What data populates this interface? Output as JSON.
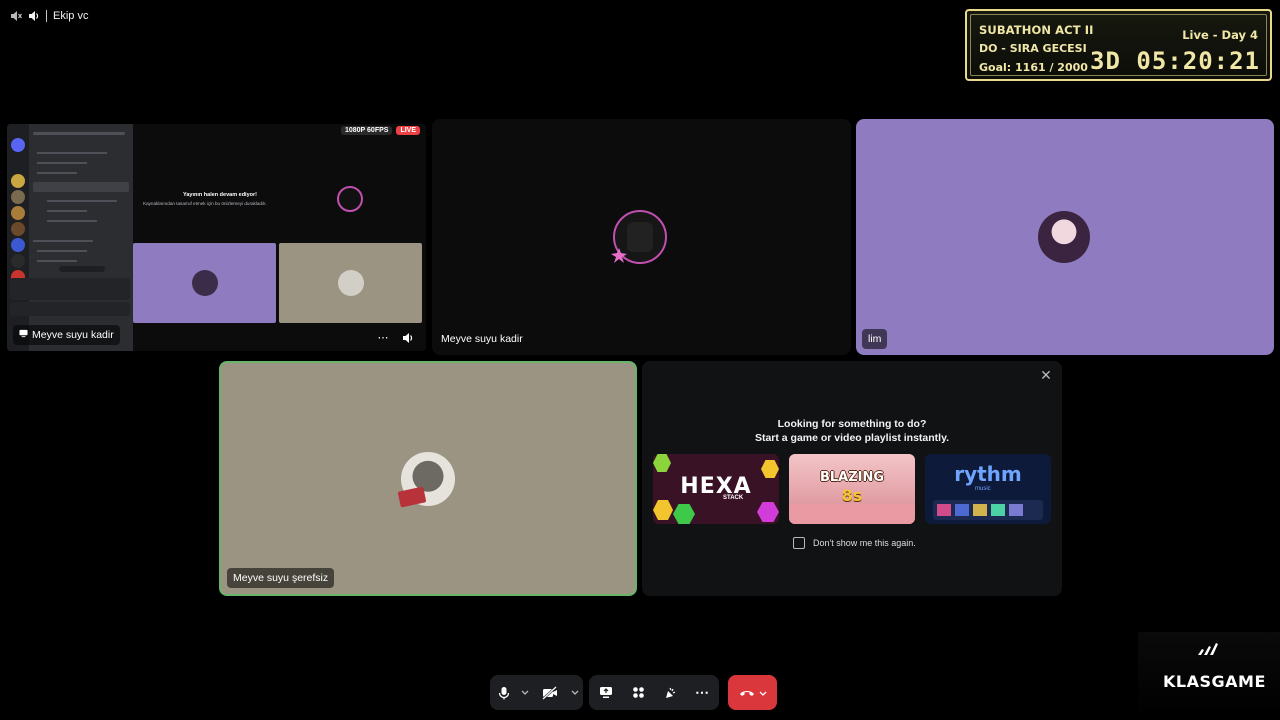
{
  "header": {
    "channel_name": "Ekip vc",
    "deafen_icon": "speaker-muted-icon",
    "volume_icon": "speaker-icon"
  },
  "subathon": {
    "title": "SUBATHON ACT II",
    "status": "Live - Day 4",
    "subtitle": "DO - SIRA GECESI",
    "goal": "Goal: 1161 / 2000",
    "timer": "3D 05:20:21"
  },
  "tiles": {
    "screen_share": {
      "name": "Meyve suyu kadir",
      "quality_badge": "1080P 60FPS",
      "live_badge": "LIVE",
      "inner_message_title": "Yayının halen devam ediyor!",
      "inner_message_body": "Kaynaklarından tasarruf etmek için bu önizlemeyi durakladık."
    },
    "middle": {
      "name": "Meyve suyu kadir"
    },
    "right": {
      "name": "lim"
    },
    "speaker": {
      "name": "Meyve suyu şerefsiz"
    }
  },
  "activity": {
    "heading_line1": "Looking for something to do?",
    "heading_line2": "Start a game or video playlist instantly.",
    "cards": [
      {
        "title": "HEXA",
        "subtitle": "STACK"
      },
      {
        "title": "BLAZING",
        "subtitle": "8s"
      },
      {
        "title": "rythm",
        "subtitle": "music"
      }
    ],
    "checkbox_label": "Don't show me this again."
  },
  "colors": {
    "accent_live": "#ed4245",
    "speaking_border": "#67b56b",
    "leave_button": "#da373c",
    "tile_purple": "#8e7bc0",
    "tile_beige": "#9c9482"
  },
  "watermark": {
    "part1": "KLAS",
    "part2": "GAME"
  }
}
